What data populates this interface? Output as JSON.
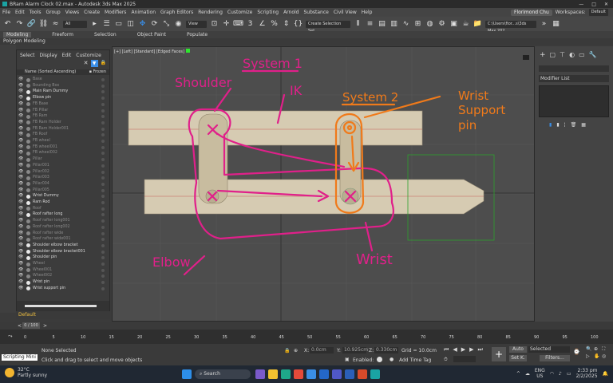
{
  "window": {
    "title": "BRam Alarm Clock 02.max - Autodesk 3ds Max 2025",
    "minimize": "—",
    "maximize": "□",
    "close": "✕"
  },
  "menu": {
    "items": [
      "File",
      "Edit",
      "Tools",
      "Group",
      "Views",
      "Create",
      "Modifiers",
      "Animation",
      "Graph Editors",
      "Rendering",
      "Customize",
      "Scripting",
      "Arnold",
      "Substance",
      "Civil View",
      "Help"
    ],
    "user": "Florimond Chu",
    "workspaces_label": "Workspaces:",
    "workspace_value": "Default"
  },
  "toolbar": {
    "filter_value": "All",
    "view_value": "View",
    "selection_set_placeholder": "Create Selection Set",
    "path_value": "C:\\Users\\fior...s\\3ds Max 202"
  },
  "ribbon": {
    "tabs": [
      "Modeling",
      "Freeform",
      "Selection",
      "Object Paint",
      "Populate"
    ],
    "active_tab": "Modeling",
    "sub_label": "Polygon Modeling"
  },
  "explorer": {
    "menu": [
      "Select",
      "Display",
      "Edit",
      "Customize"
    ],
    "column_header": "Name (Sorted Ascending)",
    "frozen_header": "▪ Frozen",
    "rows": [
      {
        "name": "Base",
        "dim": true
      },
      {
        "name": "Bounding Box",
        "dim": true
      },
      {
        "name": "Main Ram Dummy",
        "dim": false
      },
      {
        "name": "Elbow pin",
        "dim": false
      },
      {
        "name": "FB Base",
        "dim": true
      },
      {
        "name": "FB Pillar",
        "dim": true
      },
      {
        "name": "FB Ram",
        "dim": true
      },
      {
        "name": "FB Ram Holder",
        "dim": true
      },
      {
        "name": "FB Ram Holder001",
        "dim": true
      },
      {
        "name": "FB Roof",
        "dim": true
      },
      {
        "name": "FB wheel",
        "dim": true
      },
      {
        "name": "FB wheel001",
        "dim": true
      },
      {
        "name": "FB wheel002",
        "dim": true
      },
      {
        "name": "Pillar",
        "dim": true
      },
      {
        "name": "Pillar001",
        "dim": true
      },
      {
        "name": "Pillar002",
        "dim": true
      },
      {
        "name": "Pillar003",
        "dim": true
      },
      {
        "name": "Pillar004",
        "dim": true
      },
      {
        "name": "Pillar005",
        "dim": true
      },
      {
        "name": "Wrist Dummy",
        "dim": false
      },
      {
        "name": "Ram Rod",
        "dim": false
      },
      {
        "name": "Roof",
        "dim": true
      },
      {
        "name": "Roof rafter long",
        "dim": false
      },
      {
        "name": "Roof rafter long001",
        "dim": true
      },
      {
        "name": "Roof rafter long002",
        "dim": true
      },
      {
        "name": "Roof rafter wide",
        "dim": true
      },
      {
        "name": "Roof rafter wide001",
        "dim": true
      },
      {
        "name": "Shoulder elbow bracket",
        "dim": false
      },
      {
        "name": "Shoulder elbow bracket001",
        "dim": false
      },
      {
        "name": "Shoulder pin",
        "dim": false
      },
      {
        "name": "Wheel",
        "dim": true
      },
      {
        "name": "Wheel001",
        "dim": true
      },
      {
        "name": "Wheel002",
        "dim": true
      },
      {
        "name": "Wrist pin",
        "dim": false
      },
      {
        "name": "Wrist support pin",
        "dim": false
      }
    ],
    "layer_value": "Default"
  },
  "viewport": {
    "label": "[+] [Left] [Standard] [Edged Faces]",
    "annotations": {
      "system1": "System 1",
      "shoulder": "Shoulder",
      "ik": "IK",
      "system2": "System 2",
      "wrist_support_pin": [
        "Wrist",
        "Support",
        "pin"
      ],
      "elbow": "Elbow",
      "wrist": "Wrist"
    }
  },
  "rightpanel": {
    "modifier_list": "Modifier List"
  },
  "timeline": {
    "frame_counter": "0 / 100",
    "ticks": [
      "0",
      "5",
      "10",
      "15",
      "20",
      "25",
      "30",
      "35",
      "40",
      "45",
      "50",
      "55",
      "60",
      "65",
      "70",
      "75",
      "80",
      "85",
      "90",
      "95",
      "100"
    ]
  },
  "status": {
    "script_label": "Scripting Mini",
    "selection": "None Selected",
    "prompt": "Click and drag to select and move objects",
    "x_label": "X:",
    "x_value": "0.0cm",
    "y_label": "Y:",
    "y_value": "10.925cm",
    "z_label": "Z:",
    "z_value": "0.330cm",
    "grid": "Grid = 10.0cm",
    "enabled_label": "Enabled:",
    "add_time_tag": "Add Time Tag",
    "auto_label": "Auto",
    "set_key_label": "Set K.",
    "selected_dd": "Selected",
    "filters_label": "Filters..."
  },
  "taskbar": {
    "weather_temp": "32°C",
    "weather_desc": "Partly sunny",
    "search_placeholder": "Search",
    "lang1": "ENG",
    "lang2": "US",
    "time": "2:33 pm",
    "date": "2/2/2025"
  },
  "colors": {
    "pink": "#e0208a",
    "orange": "#f07a1a",
    "wood": "#d6cbb2",
    "viewport_bg": "#4d4d4d",
    "accent_blue": "#3a8ee6"
  }
}
